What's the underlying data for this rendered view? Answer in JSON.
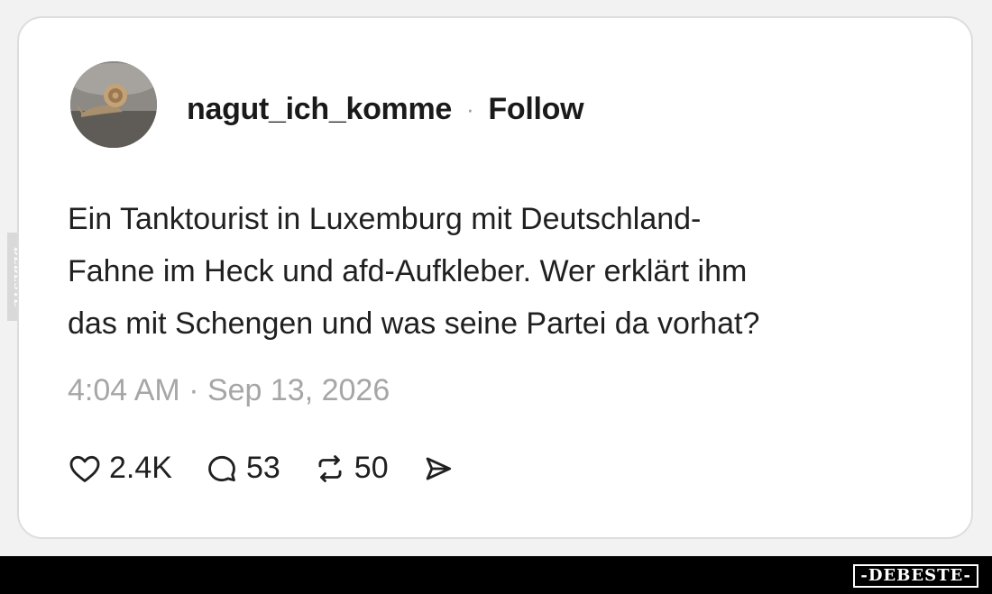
{
  "post": {
    "username": "nagut_ich_komme",
    "separator": "·",
    "follow_label": "Follow",
    "text": "Ein Tanktourist in Luxemburg mit Deutschland-\nFahne im Heck und afd-Aufkleber. Wer erklärt ihm\ndas mit Schengen und was seine Partei da vorhat?",
    "timestamp": "4:04 AM · Sep 13, 2026",
    "avatar_icon": "snail-photo-avatar"
  },
  "actions": {
    "likes": "2.4K",
    "like_icon": "heart-icon",
    "replies": "53",
    "reply_icon": "comment-bubble-icon",
    "reposts": "50",
    "repost_icon": "repost-icon",
    "share_icon": "send-icon"
  },
  "watermark": {
    "logo_text": "-DEBESTE-",
    "side_text": "DEBESTE"
  },
  "colors": {
    "background": "#f2f2f2",
    "card": "#ffffff",
    "text": "#202020",
    "muted": "#a6a6a6",
    "watermark_bar": "#000000"
  }
}
